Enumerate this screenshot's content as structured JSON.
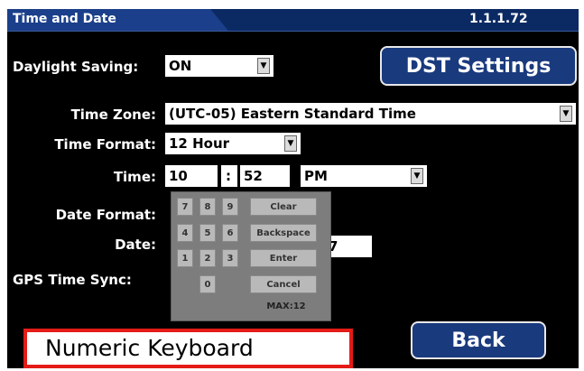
{
  "header": {
    "tab_title": "Time and Date",
    "version": "1.1.1.72"
  },
  "form": {
    "daylight_saving": {
      "label": "Daylight Saving:",
      "value": "ON"
    },
    "dst_settings_button": "DST Settings",
    "time_zone": {
      "label": "Time Zone:",
      "value": "(UTC-05) Eastern Standard Time"
    },
    "time_format": {
      "label": "Time Format:",
      "value": "12 Hour"
    },
    "time": {
      "label": "Time:",
      "hour": "10",
      "separator": ":",
      "minute": "52",
      "ampm": "PM"
    },
    "date_format": {
      "label": "Date Format:"
    },
    "date": {
      "label": "Date:",
      "partial_value": "7"
    },
    "gps_time_sync": {
      "label": "GPS Time Sync:"
    }
  },
  "keypad": {
    "keys": {
      "k7": "7",
      "k8": "8",
      "k9": "9",
      "k4": "4",
      "k5": "5",
      "k6": "6",
      "k1": "1",
      "k2": "2",
      "k3": "3",
      "k0": "0",
      "clear": "Clear",
      "backspace": "Backspace",
      "enter": "Enter",
      "cancel": "Cancel"
    },
    "max_label": "MAX:12"
  },
  "back_button": "Back",
  "caption": "Numeric Keyboard",
  "colors": {
    "background": "#000000",
    "header": "#0b2a63",
    "tab": "#1b3f8a",
    "button": "#1a3a7e",
    "caption_border": "#e41b17",
    "keypad": "#7d7d7d"
  }
}
